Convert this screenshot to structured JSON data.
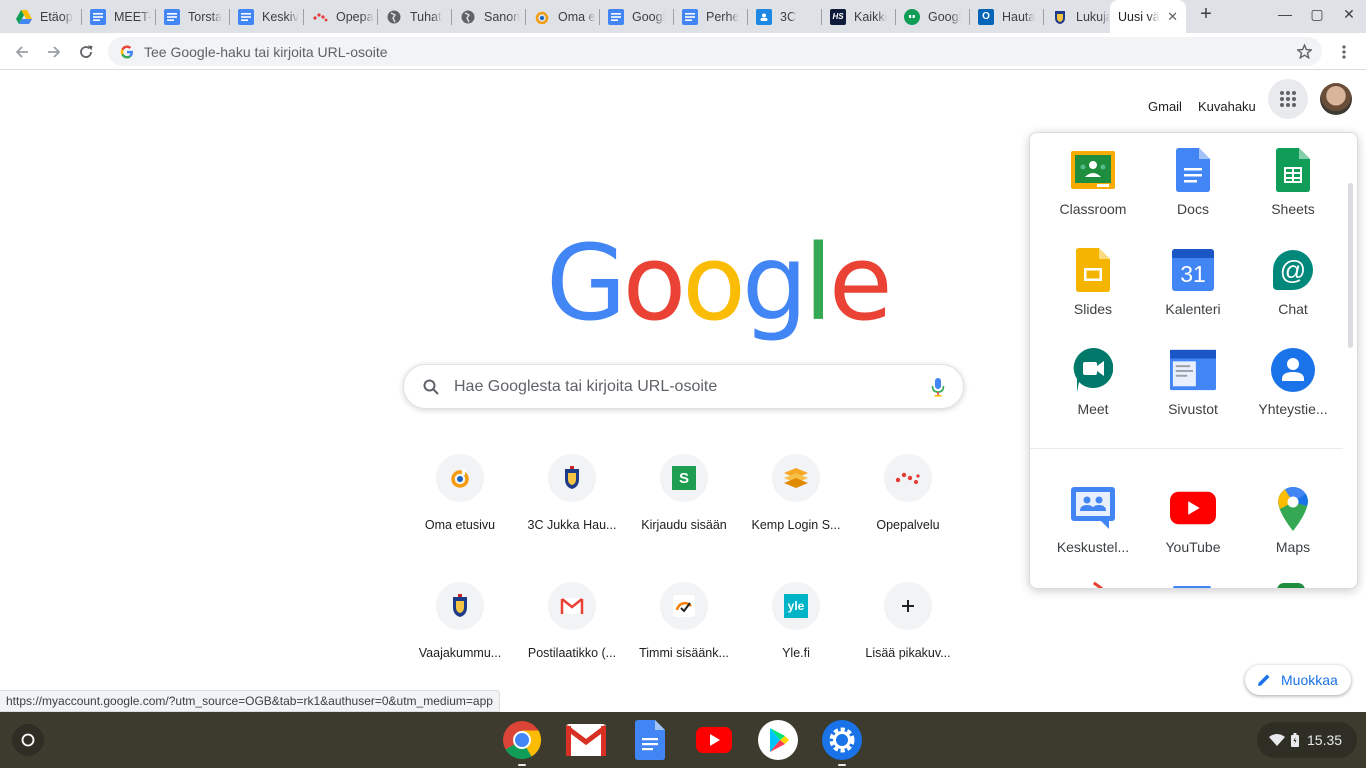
{
  "tabs": [
    {
      "title": "Etäop",
      "icon": "drive-icon"
    },
    {
      "title": "MEET-",
      "icon": "docs-icon"
    },
    {
      "title": "Torsta",
      "icon": "docs-icon"
    },
    {
      "title": "Keskiv",
      "icon": "docs-icon"
    },
    {
      "title": "Opepa",
      "icon": "opepalvelu-icon"
    },
    {
      "title": "Tuhat",
      "icon": "globe-icon"
    },
    {
      "title": "Sanon",
      "icon": "globe-icon"
    },
    {
      "title": "Oma e",
      "icon": "oma-icon"
    },
    {
      "title": "Googl",
      "icon": "docs-icon"
    },
    {
      "title": "Perhe",
      "icon": "docs-icon"
    },
    {
      "title": "3C",
      "icon": "classroom-icon"
    },
    {
      "title": "Kaikki",
      "icon": "hs-icon"
    },
    {
      "title": "Googl",
      "icon": "hangouts-icon"
    },
    {
      "title": "Hauta",
      "icon": "outlook-icon"
    },
    {
      "title": "Lukuja",
      "icon": "crest-icon"
    },
    {
      "title": "Uusi vä",
      "icon": "none",
      "active": true
    }
  ],
  "new_tab_label": "+",
  "window": {
    "minimize": "—",
    "maximize": "▢",
    "close": "✕"
  },
  "omnibox": {
    "placeholder": "Tee Google-haku tai kirjoita URL-osoite"
  },
  "top_links": {
    "gmail": "Gmail",
    "images": "Kuvahaku"
  },
  "logo": [
    "G",
    "o",
    "o",
    "g",
    "l",
    "e"
  ],
  "logo_colors": [
    "#4285f4",
    "#ea4335",
    "#fbbc05",
    "#4285f4",
    "#34a853",
    "#ea4335"
  ],
  "search": {
    "placeholder": "Hae Googlesta tai kirjoita URL-osoite"
  },
  "shortcuts": [
    {
      "label": "Oma etusivu",
      "icon": "oma-icon"
    },
    {
      "label": "3C Jukka Hau...",
      "icon": "crest-icon"
    },
    {
      "label": "Kirjaudu sisään",
      "icon": "s-icon"
    },
    {
      "label": "Kemp Login S...",
      "icon": "kemp-icon"
    },
    {
      "label": "Opepalvelu",
      "icon": "opepalvelu-icon"
    },
    {
      "label": "Vaajakummu...",
      "icon": "crest-icon"
    },
    {
      "label": "Postilaatikko (...",
      "icon": "gmail-icon"
    },
    {
      "label": "Timmi sisäänk...",
      "icon": "timmi-icon"
    },
    {
      "label": "Yle.fi",
      "icon": "yle-icon"
    },
    {
      "label": "Lisää pikakuv...",
      "icon": "add-icon"
    }
  ],
  "yle_text": "yle",
  "s_text": "S",
  "apps": [
    {
      "name": "Classroom",
      "icon": "classroom-icon"
    },
    {
      "name": "Docs",
      "icon": "docs-icon"
    },
    {
      "name": "Sheets",
      "icon": "sheets-icon"
    },
    {
      "name": "Slides",
      "icon": "slides-icon"
    },
    {
      "name": "Kalenteri",
      "icon": "calendar-icon"
    },
    {
      "name": "Chat",
      "icon": "chat-icon"
    },
    {
      "name": "Meet",
      "icon": "meet-icon"
    },
    {
      "name": "Sivustot",
      "icon": "sites-icon"
    },
    {
      "name": "Yhteystie...",
      "icon": "contacts-icon"
    },
    {
      "name": "Keskustel...",
      "icon": "groups-icon"
    },
    {
      "name": "YouTube",
      "icon": "youtube-icon"
    },
    {
      "name": "Maps",
      "icon": "maps-icon"
    }
  ],
  "calendar_day": "31",
  "chat_symbol": "@",
  "status_url": "https://myaccount.google.com/?utm_source=OGB&tab=rk1&authuser=0&utm_medium=app",
  "edit_button": "Muokkaa",
  "shelf_apps": [
    "chrome-icon",
    "gmail-icon",
    "docs-icon",
    "youtube-icon",
    "play-store-icon",
    "settings-icon"
  ],
  "clock": "15.35"
}
